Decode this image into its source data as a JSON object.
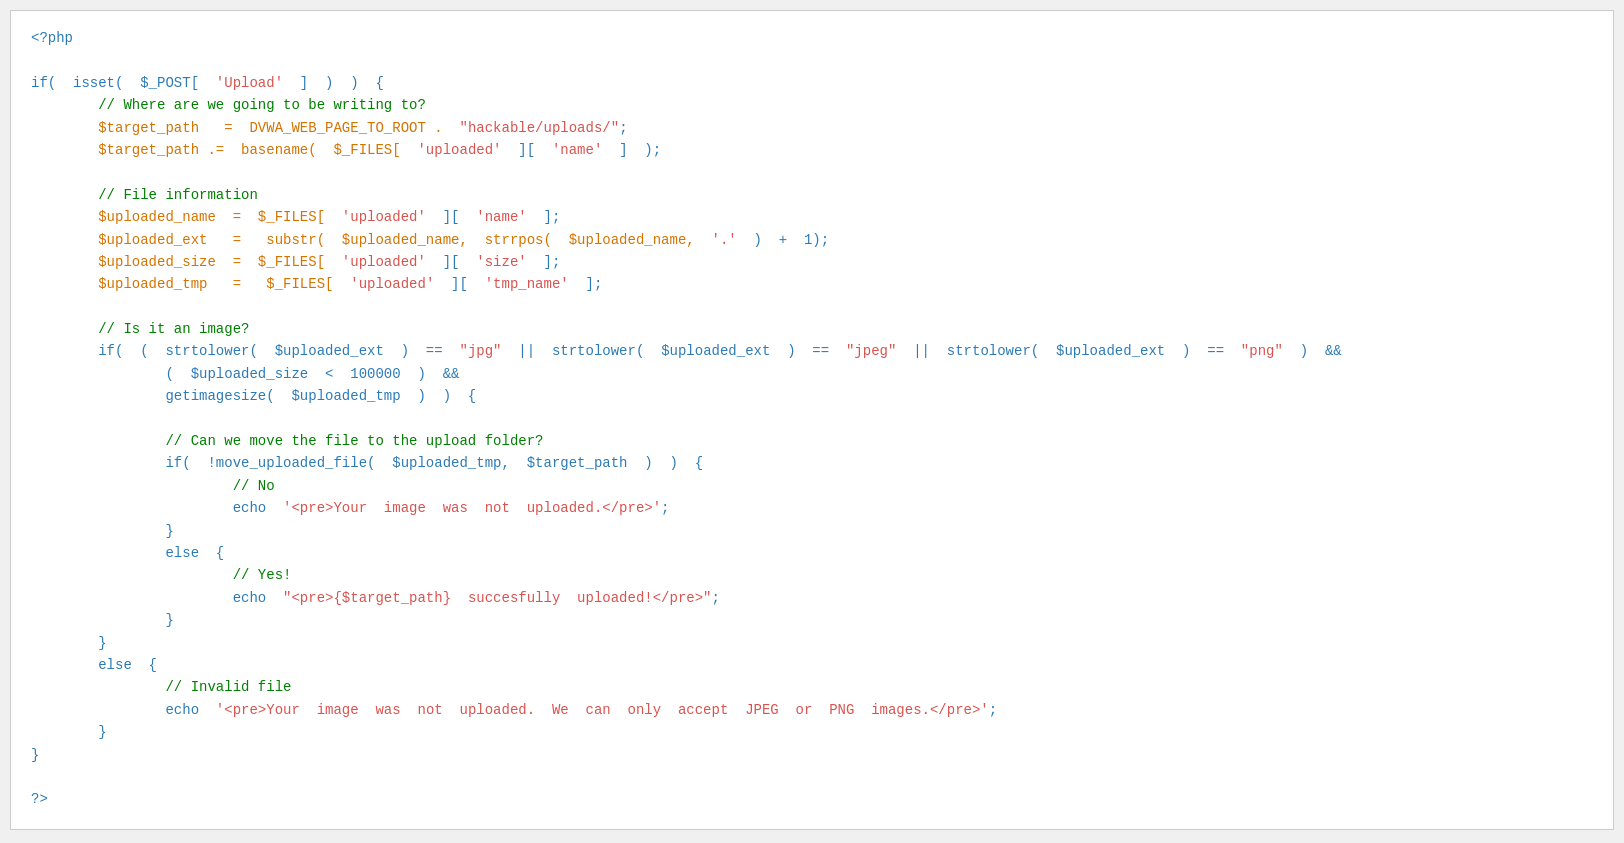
{
  "code": {
    "lines": [
      {
        "tokens": [
          {
            "text": "<?php",
            "class": "c-php-tag"
          }
        ]
      },
      {
        "tokens": []
      },
      {
        "tokens": [
          {
            "text": "if(  isset(  $_POST[  ",
            "class": "c-keyword"
          },
          {
            "text": "'Upload'",
            "class": "c-string"
          },
          {
            "text": "  ]  )  )  {",
            "class": "c-keyword"
          }
        ]
      },
      {
        "tokens": [
          {
            "text": "        // Where are we going to be writing to?",
            "class": "c-comment"
          }
        ]
      },
      {
        "tokens": [
          {
            "text": "        $target_path   =  DVWA_WEB_PAGE_TO_ROOT .  ",
            "class": "c-var"
          },
          {
            "text": "\"hackable/uploads/\"",
            "class": "c-string"
          },
          {
            "text": ";",
            "class": "c-default"
          }
        ]
      },
      {
        "tokens": [
          {
            "text": "        $target_path .=  basename(  $_FILES[  ",
            "class": "c-var"
          },
          {
            "text": "'uploaded'",
            "class": "c-string"
          },
          {
            "text": "  ][  ",
            "class": "c-default"
          },
          {
            "text": "'name'",
            "class": "c-string"
          },
          {
            "text": "  ]  );",
            "class": "c-default"
          }
        ]
      },
      {
        "tokens": []
      },
      {
        "tokens": [
          {
            "text": "        // File information",
            "class": "c-comment"
          }
        ]
      },
      {
        "tokens": [
          {
            "text": "        $uploaded_name  =  $_FILES[  ",
            "class": "c-var"
          },
          {
            "text": "'uploaded'",
            "class": "c-string"
          },
          {
            "text": "  ][  ",
            "class": "c-default"
          },
          {
            "text": "'name'",
            "class": "c-string"
          },
          {
            "text": "  ];",
            "class": "c-default"
          }
        ]
      },
      {
        "tokens": [
          {
            "text": "        $uploaded_ext   =   substr(  $uploaded_name,  strrpos(  $uploaded_name,  ",
            "class": "c-var"
          },
          {
            "text": "'.'",
            "class": "c-string"
          },
          {
            "text": "  )  +  1);",
            "class": "c-default"
          }
        ]
      },
      {
        "tokens": [
          {
            "text": "        $uploaded_size  =  $_FILES[  ",
            "class": "c-var"
          },
          {
            "text": "'uploaded'",
            "class": "c-string"
          },
          {
            "text": "  ][  ",
            "class": "c-default"
          },
          {
            "text": "'size'",
            "class": "c-string"
          },
          {
            "text": "  ];",
            "class": "c-default"
          }
        ]
      },
      {
        "tokens": [
          {
            "text": "        $uploaded_tmp   =   $_FILES[  ",
            "class": "c-var"
          },
          {
            "text": "'uploaded'",
            "class": "c-string"
          },
          {
            "text": "  ][  ",
            "class": "c-default"
          },
          {
            "text": "'tmp_name'",
            "class": "c-string"
          },
          {
            "text": "  ];",
            "class": "c-default"
          }
        ]
      },
      {
        "tokens": []
      },
      {
        "tokens": [
          {
            "text": "        // Is it an image?",
            "class": "c-comment"
          }
        ]
      },
      {
        "tokens": [
          {
            "text": "        if(  (  strtolower(  $uploaded_ext  )  ==  ",
            "class": "c-keyword"
          },
          {
            "text": "\"jpg\"",
            "class": "c-string"
          },
          {
            "text": "  ||  strtolower(  $uploaded_ext  )  ==  ",
            "class": "c-keyword"
          },
          {
            "text": "\"jpeg\"",
            "class": "c-string"
          },
          {
            "text": "  ||  strtolower(  $uploaded_ext  )  ==  ",
            "class": "c-keyword"
          },
          {
            "text": "\"png\"",
            "class": "c-string"
          },
          {
            "text": "  )  &&",
            "class": "c-keyword"
          }
        ]
      },
      {
        "tokens": [
          {
            "text": "                (  $uploaded_size  <  100000  )  &&",
            "class": "c-keyword"
          }
        ]
      },
      {
        "tokens": [
          {
            "text": "                getimagesize(  $uploaded_tmp  )  )  {",
            "class": "c-keyword"
          }
        ]
      },
      {
        "tokens": []
      },
      {
        "tokens": [
          {
            "text": "                // Can we move the file to the upload folder?",
            "class": "c-comment"
          }
        ]
      },
      {
        "tokens": [
          {
            "text": "                if(  !move_uploaded_file(  $uploaded_tmp,  $target_path  )  )  {",
            "class": "c-keyword"
          }
        ]
      },
      {
        "tokens": [
          {
            "text": "                        // No",
            "class": "c-comment"
          }
        ]
      },
      {
        "tokens": [
          {
            "text": "                        echo  ",
            "class": "c-keyword"
          },
          {
            "text": "'<pre>Your  image  was  not  uploaded.</pre>'",
            "class": "c-string"
          },
          {
            "text": ";",
            "class": "c-default"
          }
        ]
      },
      {
        "tokens": [
          {
            "text": "                }",
            "class": "c-default"
          }
        ]
      },
      {
        "tokens": [
          {
            "text": "                else  {",
            "class": "c-keyword"
          }
        ]
      },
      {
        "tokens": [
          {
            "text": "                        // Yes!",
            "class": "c-comment"
          }
        ]
      },
      {
        "tokens": [
          {
            "text": "                        echo  ",
            "class": "c-keyword"
          },
          {
            "text": "\"<pre>{$target_path}  succesfully  uploaded!</pre>\"",
            "class": "c-string"
          },
          {
            "text": ";",
            "class": "c-default"
          }
        ]
      },
      {
        "tokens": [
          {
            "text": "                }",
            "class": "c-default"
          }
        ]
      },
      {
        "tokens": [
          {
            "text": "        }",
            "class": "c-default"
          }
        ]
      },
      {
        "tokens": [
          {
            "text": "        else  {",
            "class": "c-keyword"
          }
        ]
      },
      {
        "tokens": [
          {
            "text": "                // Invalid file",
            "class": "c-comment"
          }
        ]
      },
      {
        "tokens": [
          {
            "text": "                echo  ",
            "class": "c-keyword"
          },
          {
            "text": "'<pre>Your  image  was  not  uploaded.  We  can  only  accept  JPEG  or  PNG  images.</pre>'",
            "class": "c-string"
          },
          {
            "text": ";",
            "class": "c-default"
          }
        ]
      },
      {
        "tokens": [
          {
            "text": "        }",
            "class": "c-default"
          }
        ]
      },
      {
        "tokens": [
          {
            "text": "}",
            "class": "c-default"
          }
        ]
      },
      {
        "tokens": []
      },
      {
        "tokens": [
          {
            "text": "?>",
            "class": "c-php-tag"
          }
        ]
      }
    ]
  }
}
